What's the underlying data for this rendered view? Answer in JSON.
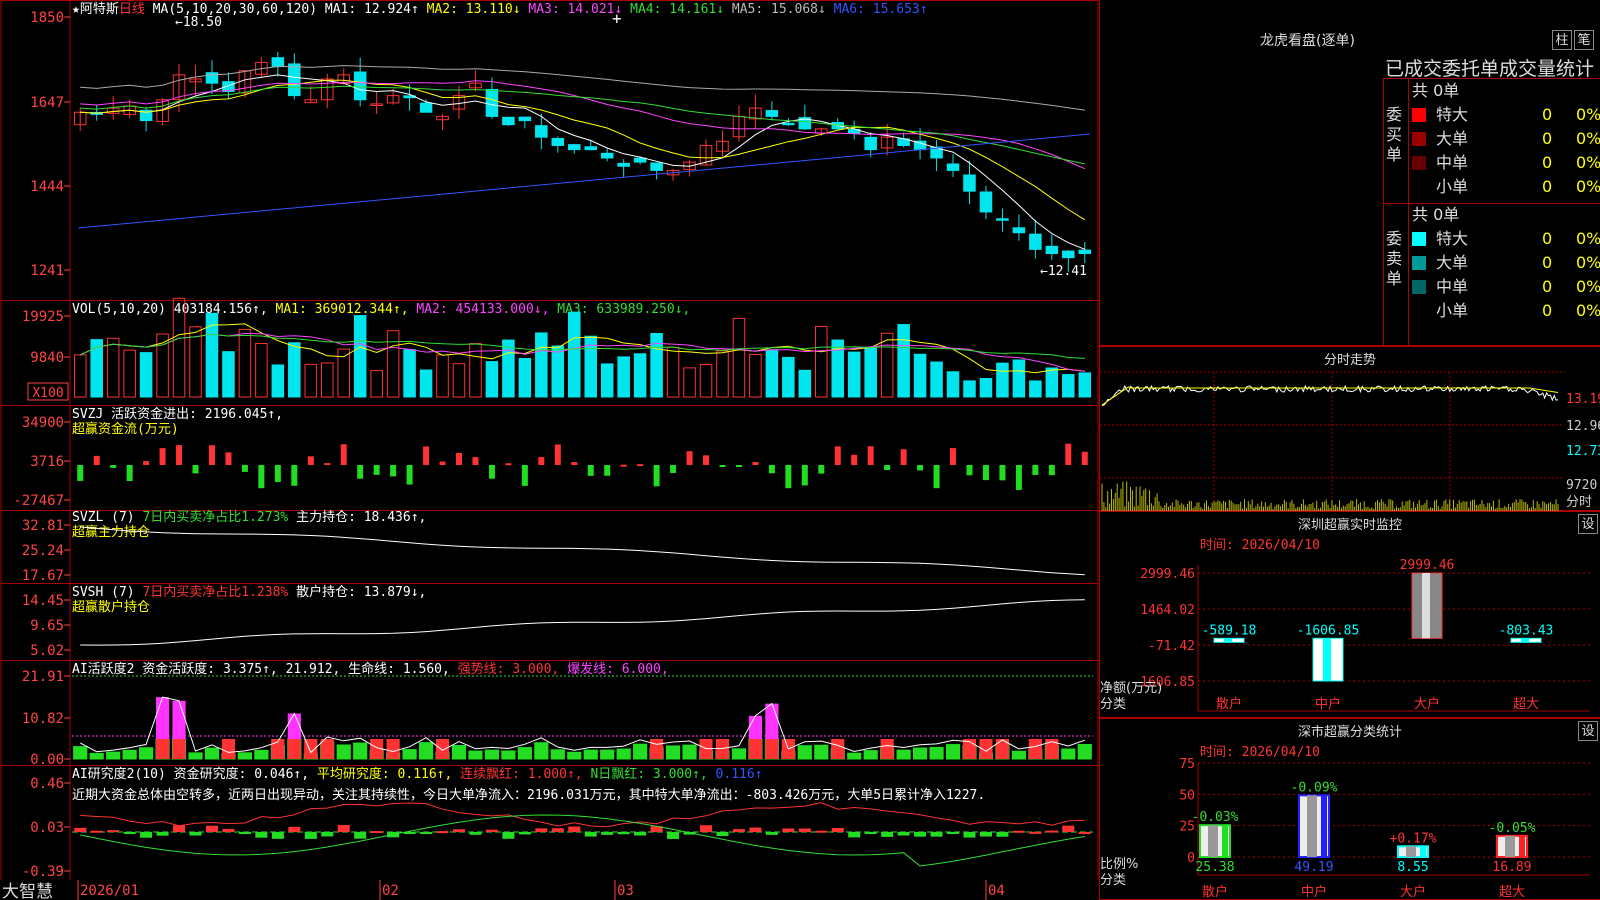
{
  "stock": {
    "star": "★",
    "name": "阿特斯",
    "period": "日线"
  },
  "colors": {
    "bg": "#000000",
    "up": "#ff3333",
    "down": "#00e5ee",
    "vol_up": "#ff3333",
    "vol_down": "#00e5ee",
    "grid": "#aa0000",
    "axis_text": "#ff4444",
    "ma1": "#ffffff",
    "ma2": "#ffff00",
    "ma3": "#ff44ff",
    "ma4": "#33dd33",
    "ma5": "#aaaaaa",
    "ma6": "#3355ff",
    "green_bar": "#22dd22",
    "magenta_bar": "#ff33ff"
  },
  "main_pane": {
    "title": "MA(5,10,20,30,60,120)",
    "ma_labels": [
      {
        "label": "MA1:",
        "value": "12.924",
        "arrow": "↑",
        "color": "#ffffff"
      },
      {
        "label": "MA2:",
        "value": "13.110",
        "arrow": "↓",
        "color": "#ffff00"
      },
      {
        "label": "MA3:",
        "value": "14.021",
        "arrow": "↓",
        "color": "#ff44ff"
      },
      {
        "label": "MA4:",
        "value": "14.161",
        "arrow": "↓",
        "color": "#33dd33"
      },
      {
        "label": "MA5:",
        "value": "15.068",
        "arrow": "↓",
        "color": "#bbbbbb"
      },
      {
        "label": "MA6:",
        "value": "15.653",
        "arrow": "↑",
        "color": "#3355ff"
      }
    ],
    "y_ticks": [
      "1850",
      "1647",
      "1444",
      "1241"
    ],
    "high_mark": "18.50",
    "low_mark": "12.41"
  },
  "vol_pane": {
    "title": "VOL(5,10,20)",
    "value": "403184.156",
    "ma_labels": [
      {
        "label": "MA1:",
        "value": "369012.344",
        "arrow": "↑",
        "color": "#ffff00"
      },
      {
        "label": "MA2:",
        "value": "454133.000",
        "arrow": "↓",
        "color": "#ff44ff"
      },
      {
        "label": "MA3:",
        "value": "633989.250",
        "arrow": "↓",
        "color": "#33dd33"
      }
    ],
    "y_ticks": [
      "19925",
      "9840"
    ],
    "multiplier": "X100"
  },
  "svzj_pane": {
    "title": "SVZJ",
    "label": "活跃资金进出:",
    "value": "2196.045",
    "subtitle": "超赢资金流(万元)",
    "y_ticks": [
      "34900",
      "3716",
      "-27467"
    ]
  },
  "svzl_pane": {
    "title": "SVZL (7)",
    "label1": "7日内买卖净占比1.273%",
    "label2": "主力持仓:",
    "value": "18.436",
    "subtitle": "超赢主力持仓",
    "y_ticks": [
      "32.81",
      "25.24",
      "17.67"
    ]
  },
  "svsh_pane": {
    "title": "SVSH (7)",
    "label1": "7日内买卖净占比1.238%",
    "label2": "散户持仓:",
    "value": "13.879",
    "subtitle": "超赢散户持仓",
    "y_ticks": [
      "14.45",
      "9.65",
      "5.02"
    ]
  },
  "ai_pane": {
    "title": "AI活跃度2",
    "label": "资金活跃度:",
    "value": "3.375",
    "v2": "21.912",
    "label3": "生命线:",
    "v3": "1.560",
    "label4": "强势线:",
    "v4": "3.000",
    "label5": "爆发线:",
    "v5": "6.000",
    "y_ticks": [
      "21.91",
      "10.82",
      "0.00"
    ]
  },
  "ai2_pane": {
    "title": "AI研究度2(10)",
    "label": "资金研究度:",
    "value": "0.046",
    "label2": "平均研究度:",
    "v2": "0.116",
    "label3": "连续飘红:",
    "v3": "1.000",
    "label4": "N日飘红:",
    "v4": "3.000",
    "v5": "0.116",
    "note": "近期大资金总体由空转多，近两日出现异动，关注其持续性，今日大单净流入：2196.031万元，其中特大单净流出：-803.426万元，大单5日累计净入1227.",
    "y_ticks": [
      "0.46",
      "0.03",
      "-0.39"
    ]
  },
  "bottom": {
    "logo": "大智慧",
    "dates": [
      "2026/01",
      "02",
      "03",
      "04"
    ]
  },
  "right": {
    "lhb_title": "龙虎看盘(逐单)",
    "btn_zhu": "柱",
    "btn_bi": "笔",
    "tabs": "已成交委托单成交量统计",
    "buy_label": "委买单",
    "sell_label": "委卖单",
    "buy_count": "共 0单",
    "sell_count": "共 0单",
    "buy_rows": [
      {
        "name": "特大",
        "v": "0",
        "pct": "0%",
        "color": "#ff0000"
      },
      {
        "name": "大单",
        "v": "0",
        "pct": "0%",
        "color": "#990000"
      },
      {
        "name": "中单",
        "v": "0",
        "pct": "0%",
        "color": "#660000"
      },
      {
        "name": "小单",
        "v": "0",
        "pct": "0%",
        "color": ""
      }
    ],
    "sell_rows": [
      {
        "name": "特大",
        "v": "0",
        "pct": "0%",
        "color": "#00ffff"
      },
      {
        "name": "大单",
        "v": "0",
        "pct": "0%",
        "color": "#009999"
      },
      {
        "name": "中单",
        "v": "0",
        "pct": "0%",
        "color": "#006666"
      },
      {
        "name": "小单",
        "v": "0",
        "pct": "0%",
        "color": ""
      }
    ],
    "fs_title": "分时走势",
    "fs_ticks": [
      "13.19",
      "12.96",
      "12.73",
      "9720",
      "分时"
    ],
    "monitor_title": "深圳超赢实时监控",
    "monitor_btn": "设",
    "monitor_time": "时间: 2026/04/10",
    "monitor_yticks": [
      "2999.46",
      "1464.02",
      "-71.42",
      "-1606.85"
    ],
    "monitor_ylabel": "净额(万元)",
    "monitor_xlabel": "分类",
    "class_title": "深市超赢分类统计",
    "class_btn": "设",
    "class_time": "时间: 2026/04/10",
    "class_yticks": [
      "75",
      "50",
      "25",
      "0"
    ],
    "class_ylabel": "比例%",
    "class_xlabel": "分类"
  },
  "chart_data": [
    {
      "type": "bar",
      "title": "深圳超赢实时监控",
      "categories": [
        "散户",
        "中户",
        "大户",
        "超大"
      ],
      "values": [
        -589.18,
        -1606.85,
        2999.46,
        -803.43
      ],
      "ylabel": "净额(万元)",
      "ylim": [
        -1606.85,
        2999.46
      ]
    },
    {
      "type": "bar",
      "title": "深市超赢分类统计",
      "categories": [
        "散户",
        "中户",
        "大户",
        "超大"
      ],
      "values": [
        25.38,
        49.19,
        8.55,
        16.89
      ],
      "changes": [
        "-0.03%",
        "-0.09%",
        "+0.17%",
        "-0.05%"
      ],
      "ylabel": "比例%",
      "ylim": [
        0,
        75
      ]
    }
  ]
}
